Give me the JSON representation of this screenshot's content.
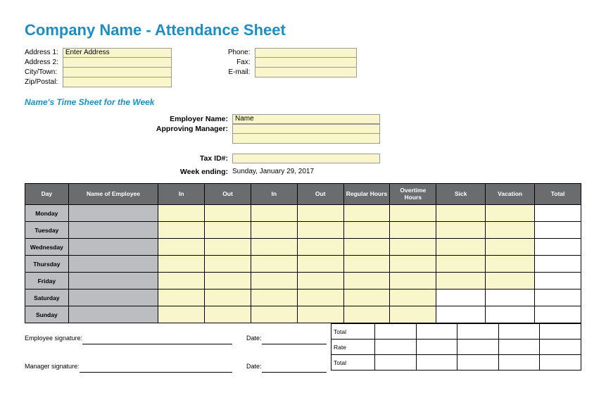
{
  "title": "Company Name - Attendance Sheet",
  "address_labels": {
    "a1": "Address 1:",
    "a2": "Address 2:",
    "city": "City/Town:",
    "zip": "Zip/Postal:"
  },
  "address_values": {
    "a1": "Enter Address",
    "a2": "",
    "city": "",
    "zip": ""
  },
  "contact_labels": {
    "phone": "Phone:",
    "fax": "Fax:",
    "email": "E-mail:"
  },
  "contact_values": {
    "phone": "",
    "fax": "",
    "email": ""
  },
  "subtitle": "Name's Time Sheet for the Week",
  "employer_label": "Employer Name:",
  "employer_value": "Name",
  "manager_label": "Approving Manager:",
  "manager_value1": "",
  "manager_value2": "",
  "taxid_label": "Tax ID#:",
  "taxid_value": "",
  "week_ending_label": "Week ending:",
  "week_ending_value": "Sunday, January 29, 2017",
  "headers": {
    "day": "Day",
    "name": "Name of Employee",
    "in1": "In",
    "out1": "Out",
    "in2": "In",
    "out2": "Out",
    "reg": "Regular Hours",
    "ot": "Overtime Hours",
    "sick": "Sick",
    "vac": "Vacation",
    "total": "Total"
  },
  "days": {
    "mon": "Monday",
    "tue": "Tuesday",
    "wed": "Wednesday",
    "thu": "Thursday",
    "fri": "Friday",
    "sat": "Saturday",
    "sun": "Sunday"
  },
  "summary": {
    "total": "Total",
    "rate": "Rate",
    "gtotal": "Total"
  },
  "sig": {
    "emp": "Employee signature:",
    "mgr": "Manager signature:",
    "date": "Date:"
  }
}
